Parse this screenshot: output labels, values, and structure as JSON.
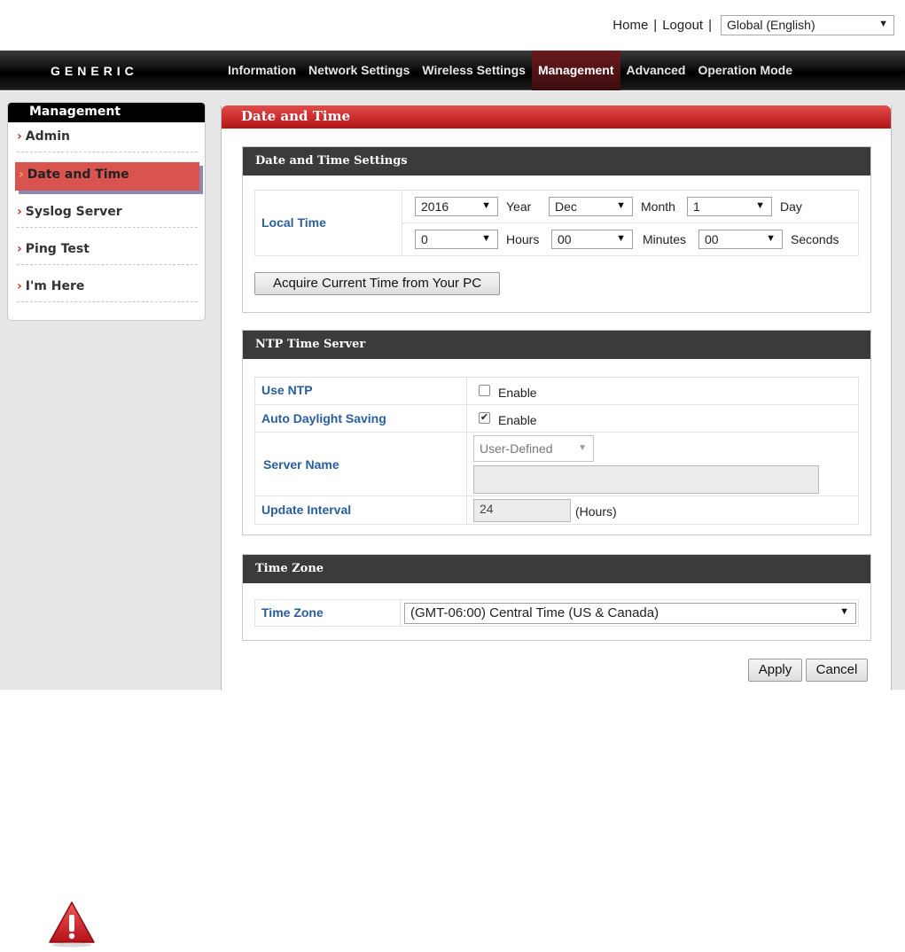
{
  "top": {
    "home": "Home",
    "logout": "Logout",
    "separator": "|",
    "language": "Global (English)"
  },
  "nav": {
    "logo": "GENERIC",
    "tabs": [
      {
        "label": "Information",
        "active": false
      },
      {
        "label": "Network Settings",
        "active": false
      },
      {
        "label": "Wireless Settings",
        "active": false
      },
      {
        "label": "Management",
        "active": true
      },
      {
        "label": "Advanced",
        "active": false
      },
      {
        "label": "Operation Mode",
        "active": false
      }
    ]
  },
  "sidebar": {
    "title": "Management",
    "chevron": "›",
    "items": [
      {
        "label": "Admin",
        "active": false
      },
      {
        "label": "Date and Time",
        "active": true
      },
      {
        "label": "Syslog Server",
        "active": false
      },
      {
        "label": "Ping Test",
        "active": false
      },
      {
        "label": "I'm Here",
        "active": false
      }
    ]
  },
  "main": {
    "title": "Date and Time",
    "dts": {
      "title": "Date and Time Settings",
      "local_time_label": "Local Time",
      "year_value": "2016",
      "year_unit": "Year",
      "month_value": "Dec",
      "month_unit": "Month",
      "day_value": "1",
      "day_unit": "Day",
      "hours_value": "0",
      "hours_unit": "Hours",
      "minutes_value": "00",
      "minutes_unit": "Minutes",
      "seconds_value": "00",
      "seconds_unit": "Seconds",
      "acquire_button": "Acquire Current Time from Your PC"
    },
    "ntp": {
      "title": "NTP Time Server",
      "use_ntp_label": "Use NTP",
      "use_ntp_checked": false,
      "use_ntp_option": "Enable",
      "auto_dst_label": "Auto Daylight Saving",
      "auto_dst_checked": true,
      "auto_dst_option": "Enable",
      "server_name_label": "Server Name",
      "server_select": "User-Defined",
      "server_value": "",
      "update_interval_label": "Update Interval",
      "update_interval_value": "24",
      "update_interval_unit": "(Hours)"
    },
    "tz": {
      "title": "Time Zone",
      "label": "Time Zone",
      "value": "(GMT-06:00) Central Time (US & Canada)"
    },
    "apply_button": "Apply",
    "cancel_button": "Cancel"
  },
  "icons": {
    "dropdown": "▼",
    "dropdown_disabled": "▼",
    "checkmark": "✔"
  },
  "colors": {
    "accent_red": "#c0392b",
    "label_blue": "#2a5d9c",
    "active_side": "#d9534f",
    "warning_red": "#d2222d"
  }
}
